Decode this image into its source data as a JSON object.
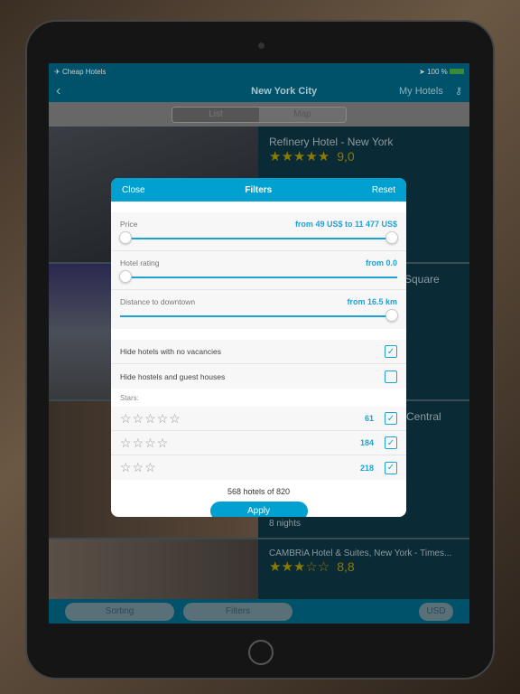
{
  "status": {
    "app": "Cheap Hotels",
    "battery": "100 %"
  },
  "nav": {
    "title": "New York City",
    "my_hotels": "My Hotels"
  },
  "segment": {
    "list": "List",
    "map": "Map"
  },
  "hotels": [
    {
      "name": "Refinery Hotel - New York",
      "stars": "★★★★★",
      "score": "9,0"
    },
    {
      "name": "Square",
      "stars": "",
      "score": ""
    },
    {
      "name": "Central",
      "stars": "",
      "score": "",
      "nights": "8 nights"
    },
    {
      "name": "CAMBRiA Hotel & Suites, New York - Times...",
      "stars": "★★★☆☆",
      "score": "8,8"
    }
  ],
  "bottom": {
    "sorting": "Sorting",
    "filters": "Filters",
    "currency": "USD"
  },
  "filters": {
    "close": "Close",
    "title": "Filters",
    "reset": "Reset",
    "price": {
      "label": "Price",
      "value": "from 49 US$ to 11 477 US$",
      "min": 0,
      "max": 1
    },
    "rating": {
      "label": "Hotel rating",
      "value": "from 0.0",
      "position": 0
    },
    "distance": {
      "label": "Distance to downtown",
      "value": "from 16.5 km",
      "position": 1
    },
    "no_vacancies": {
      "label": "Hide hotels with no vacancies",
      "checked": true
    },
    "hostels": {
      "label": "Hide hostels and guest houses",
      "checked": false
    },
    "stars_label": "Stars:",
    "star_rows": [
      {
        "stars": "☆☆☆☆☆",
        "count": "61",
        "checked": true
      },
      {
        "stars": "☆☆☆☆",
        "count": "184",
        "checked": true
      },
      {
        "stars": "☆☆☆",
        "count": "218",
        "checked": true
      }
    ],
    "summary": "568 hotels of 820",
    "apply": "Apply"
  },
  "colors": {
    "accent": "#00a0d0",
    "nav": "#00526a",
    "star": "#8a7a00"
  }
}
